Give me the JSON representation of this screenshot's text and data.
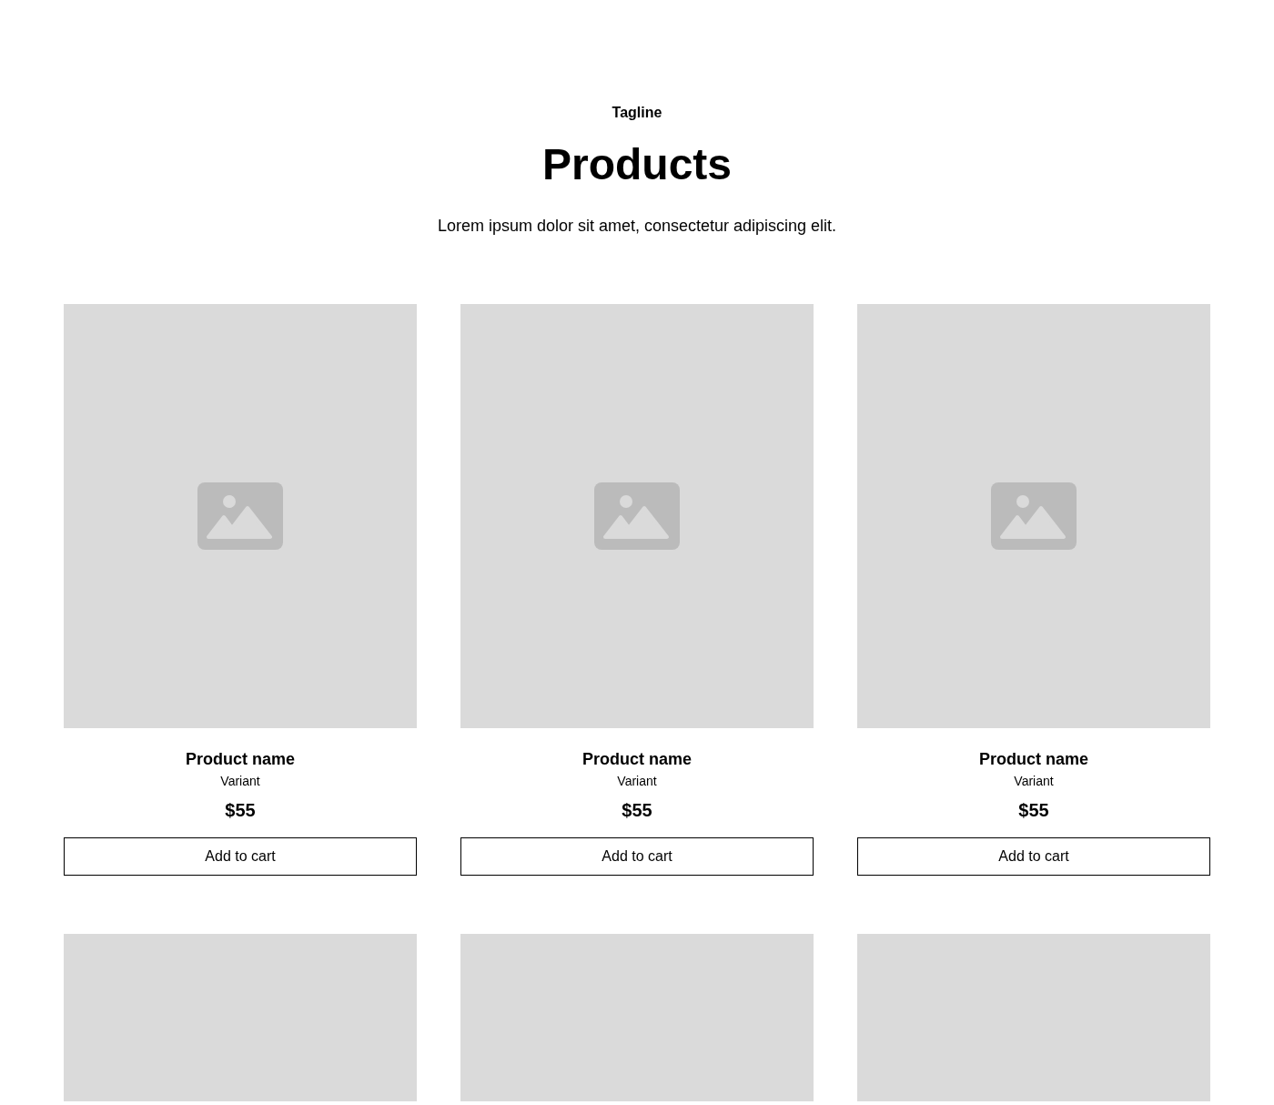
{
  "header": {
    "tagline": "Tagline",
    "title": "Products",
    "description": "Lorem ipsum dolor sit amet, consectetur adipiscing elit."
  },
  "products": [
    {
      "kind": "card",
      "name": "Product name",
      "variant": "Variant",
      "price": "$55",
      "button": "Add to cart"
    },
    {
      "kind": "card",
      "name": "Product name",
      "variant": "Variant",
      "price": "$55",
      "button": "Add to cart"
    },
    {
      "kind": "card",
      "name": "Product name",
      "variant": "Variant",
      "price": "$55",
      "button": "Add to cart"
    },
    {
      "kind": "image-only"
    },
    {
      "kind": "image-only"
    },
    {
      "kind": "image-only"
    }
  ]
}
